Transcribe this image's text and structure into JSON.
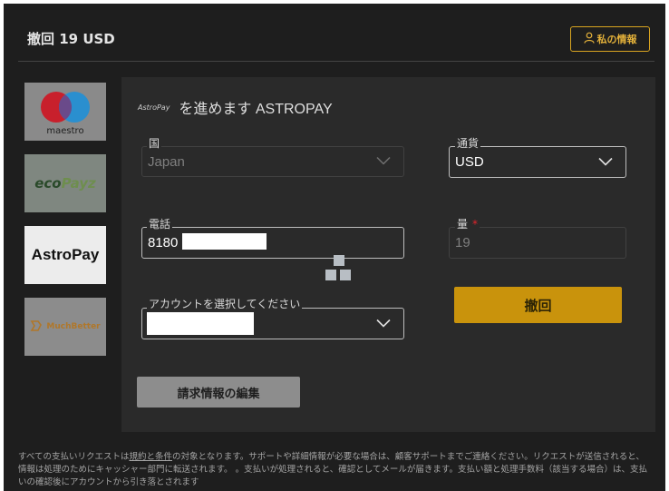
{
  "header": {
    "title": "撤回 19 USD",
    "my_info_label": "私の情報"
  },
  "payment_methods": [
    {
      "name": "maestro",
      "label": "maestro"
    },
    {
      "name": "ecopayz",
      "label_eco": "eco",
      "label_payz": "Payz"
    },
    {
      "name": "astropay",
      "label": "AstroPay"
    },
    {
      "name": "muchbetter",
      "label": "MuchBetter"
    }
  ],
  "provider": {
    "logo_text": "AstroPay",
    "heading": "を進めます ASTROPAY"
  },
  "form": {
    "country_label": "国",
    "country_value": "Japan",
    "currency_label": "通貨",
    "currency_value": "USD",
    "phone_label": "電話",
    "phone_value": "8180",
    "amount_label": "量",
    "amount_required": "*",
    "amount_value": "19",
    "account_label": "アカウントを選択してください",
    "withdraw_label": "撤回",
    "edit_billing_label": "請求情報の編集"
  },
  "footer": {
    "text_before": "すべての支払いリクエストは",
    "terms_link": "規約と条件",
    "text_after": "の対象となります。サポートや詳細情報が必要な場合は、顧客サポートまでご連絡ください。リクエストが送信されると、情報は処理のためにキャッシャー部門に転送されます。 。支払いが処理されると、確認としてメールが届きます。支払い額と処理手数料（該当する場合）は、支払いの確認後にアカウントから引き落とされます"
  },
  "colors": {
    "accent": "#c9930c",
    "background": "#1e1e1e",
    "panel": "#2a2a2a"
  }
}
